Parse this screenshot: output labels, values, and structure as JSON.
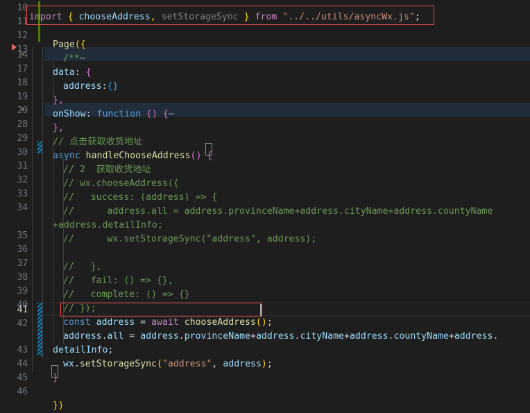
{
  "editor": {
    "language": "javascript",
    "theme": "Dark+ (default dark)",
    "font_size_px": 13,
    "line_height_px": 20,
    "active_line": 41,
    "colors": {
      "background": "#1e1e1e",
      "foreground": "#d4d4d4",
      "line_number": "#6e7681",
      "active_line_number": "#c6c6c6",
      "folded_region_background": "#212d3a",
      "error_box_border": "#f14c4c",
      "bracket_match_border": "#888f7a",
      "gutter_modified": "#487e02",
      "gutter_selection_stripe": "#0e86c9",
      "breakpoint": "#e06c63",
      "indent_guide": "#404040",
      "keyword": "#c586c0",
      "control_keyword": "#569cd6",
      "identifier": "#9cdcfe",
      "function": "#dcdcaa",
      "string": "#ce9178",
      "comment": "#6a9955"
    }
  },
  "lines": [
    {
      "num": "10",
      "text": ""
    },
    {
      "num": "11",
      "text": "import { chooseAddress, setStorageSync } from \"../../utils/asyncWx.js\";"
    },
    {
      "num": "12",
      "text": ""
    },
    {
      "num": "13",
      "text": "Page({"
    },
    {
      "num": "14",
      "text": "    /** ⋯"
    },
    {
      "num": "17",
      "text": "    data: {"
    },
    {
      "num": "18",
      "text": "      address:{}"
    },
    {
      "num": "19",
      "text": "    },"
    },
    {
      "num": "20",
      "text": "    onShow: function () { ⋯"
    },
    {
      "num": "28",
      "text": "    },"
    },
    {
      "num": "29",
      "text": "    // 点击获取收货地址"
    },
    {
      "num": "30",
      "text": "    async handleChooseAddress() {"
    },
    {
      "num": "31",
      "text": "      // 2  获取收货地址"
    },
    {
      "num": "32",
      "text": "      // wx.chooseAddress({"
    },
    {
      "num": "33",
      "text": "      //   success: (address) => {"
    },
    {
      "num": "34",
      "text": "      //      address.all = address.provinceName+address.cityName+address.countyName+address.detailInfo;"
    },
    {
      "num": "35",
      "text": "      //      wx.setStorageSync(\"address\", address);"
    },
    {
      "num": "36",
      "text": ""
    },
    {
      "num": "37",
      "text": "      //   },"
    },
    {
      "num": "38",
      "text": "      //   fail: () => {},"
    },
    {
      "num": "39",
      "text": "      //   complete: () => {}"
    },
    {
      "num": "40",
      "text": "      // });"
    },
    {
      "num": "41",
      "text": "      const address = await chooseAddress();"
    },
    {
      "num": "42",
      "text": "      address.all = address.provinceName+address.cityName+address.countyName+address.detailInfo;"
    },
    {
      "num": "43",
      "text": "      wx.setStorageSync(\"address\", address);"
    },
    {
      "num": "44",
      "text": "    }"
    },
    {
      "num": "45",
      "text": ""
    },
    {
      "num": "46",
      "text": "})"
    }
  ],
  "tokens": {
    "l11": {
      "import": "import",
      "brace_open": " {",
      "chooseAddress": " chooseAddress",
      "comma": ",",
      "setStorageSync": " setStorageSync",
      "brace_close": " }",
      "from": " from",
      "path": " \"../../utils/asyncWx.js\"",
      "semi": ";"
    },
    "l13": {
      "page": "Page",
      "open": "({"
    },
    "l14": {
      "comment": "/**",
      "ellipsis": "⋯"
    },
    "l17": {
      "data": "data",
      "colon": ": ",
      "brace": "{"
    },
    "l18": {
      "address": "address",
      "colon": ":",
      "braces": "{}"
    },
    "l19": {
      "close": "},",
      "close28": "},"
    },
    "l20": {
      "onShow": "onShow",
      "colon": ": ",
      "function": "function",
      "parens": " () ",
      "brace": "{",
      "ellipsis": "⋯"
    },
    "l29": {
      "comment": "// 点击获取收货地址"
    },
    "l30": {
      "async": "async",
      "fn": " handleChooseAddress",
      "parens": "()",
      "brace": " {"
    },
    "l31": {
      "comment": "// 2  获取收货地址"
    },
    "l32": {
      "comment": "// wx.chooseAddress({"
    },
    "l33": {
      "comment": "//   success: (address) => {"
    },
    "l34a": {
      "comment": "//      address.all = address.provinceName+address.cityName+address.countyName"
    },
    "l34b": {
      "comment": "+address.detailInfo;"
    },
    "l35": {
      "comment": "//      wx.setStorageSync(\"address\", address);"
    },
    "l37": {
      "comment": "//   },"
    },
    "l38": {
      "comment": "//   fail: () => {},"
    },
    "l39": {
      "comment": "//   complete: () => {}"
    },
    "l40": {
      "comment": "// });"
    },
    "l41": {
      "const": "const",
      "address": " address",
      "eq": " = ",
      "await": "await",
      "fn": " chooseAddress",
      "parens": "()",
      "semi": ";"
    },
    "l42a": {
      "address": "address",
      "dot1": ".",
      "all": "all",
      "eq": " = ",
      "a2": "address",
      "dot2": ".",
      "provinceName": "provinceName",
      "plus1": "+",
      "a3": "address",
      "dot3": ".",
      "cityName": "cityName",
      "plus2": "+",
      "a4": "address",
      "dot4": ".",
      "countyName": "countyName",
      "plus3": "+",
      "a5": "address",
      "dot5": "."
    },
    "l42b": {
      "detailInfo": "detailInfo",
      "semi": ";"
    },
    "l43": {
      "wx": "wx",
      "dot": ".",
      "setStorageSync": "setStorageSync",
      "open": "(",
      "str": "\"address\"",
      "comma": ", ",
      "address": "address",
      "close": ")",
      "semi": ";"
    },
    "l44": {
      "brace": "}"
    },
    "l46": {
      "close": "})"
    }
  },
  "decorations": {
    "error_boxes": [
      {
        "line": "11",
        "label": "import-statement-error-box"
      },
      {
        "line": "41",
        "label": "const-address-await-error-box"
      }
    ],
    "bracket_matches": [
      {
        "line": "30",
        "char": "{"
      },
      {
        "line": "44",
        "char": "}"
      }
    ],
    "breakpoint_marker_line": "13",
    "fold_chevron_lines": [
      "14",
      "20"
    ],
    "modified_gutter_lines": [
      "10",
      "11",
      "12"
    ],
    "selection_stripe_lines": [
      "30",
      "41",
      "42",
      "43"
    ]
  }
}
